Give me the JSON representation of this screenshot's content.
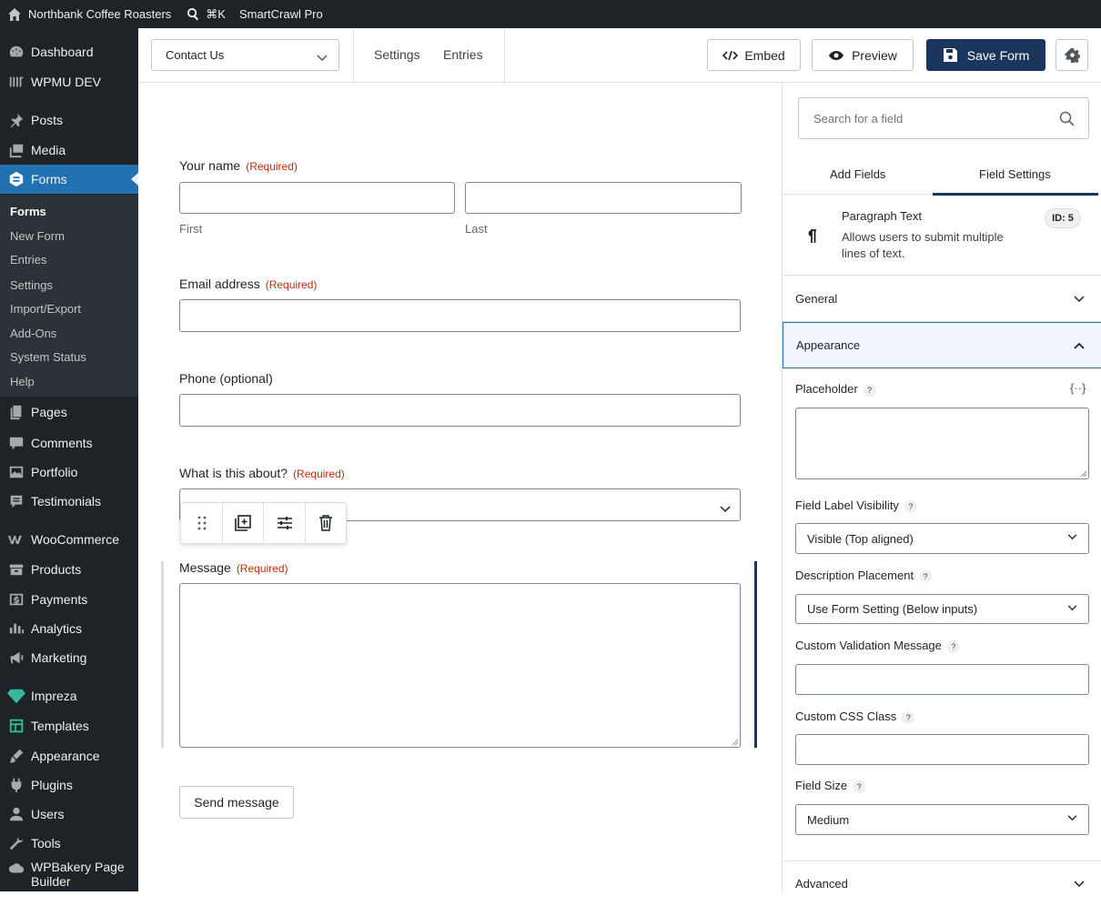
{
  "adminbar": {
    "site_name": "Northbank Coffee Roasters",
    "shortcut": "⌘K",
    "plugin": "SmartCrawl Pro"
  },
  "sidebar": {
    "items": [
      {
        "label": "Dashboard",
        "icon": "dashboard-icon"
      },
      {
        "label": "WPMU DEV",
        "icon": "wpmudev-icon"
      },
      {
        "label": "Posts",
        "icon": "pin-icon"
      },
      {
        "label": "Media",
        "icon": "media-icon"
      },
      {
        "label": "Forms",
        "icon": "forms-icon"
      },
      {
        "label": "Pages",
        "icon": "pages-icon"
      },
      {
        "label": "Comments",
        "icon": "comments-icon"
      },
      {
        "label": "Portfolio",
        "icon": "portfolio-icon"
      },
      {
        "label": "Testimonials",
        "icon": "testimonials-icon"
      },
      {
        "label": "WooCommerce",
        "icon": "woocommerce-icon"
      },
      {
        "label": "Products",
        "icon": "products-icon"
      },
      {
        "label": "Payments",
        "icon": "payments-icon"
      },
      {
        "label": "Analytics",
        "icon": "analytics-icon"
      },
      {
        "label": "Marketing",
        "icon": "marketing-icon"
      },
      {
        "label": "Impreza",
        "icon": "impreza-icon"
      },
      {
        "label": "Templates",
        "icon": "templates-icon"
      },
      {
        "label": "Appearance",
        "icon": "appearance-icon"
      },
      {
        "label": "Plugins",
        "icon": "plugins-icon"
      },
      {
        "label": "Users",
        "icon": "users-icon"
      },
      {
        "label": "Tools",
        "icon": "tools-icon"
      },
      {
        "label": "WPBakery Page Builder",
        "icon": "wpbakery-icon"
      }
    ],
    "submenu": [
      "Forms",
      "New Form",
      "Entries",
      "Settings",
      "Import/Export",
      "Add-Ons",
      "System Status",
      "Help"
    ]
  },
  "toolbar": {
    "form_select": "Contact Us",
    "tab_settings": "Settings",
    "tab_entries": "Entries",
    "embed": "Embed",
    "preview": "Preview",
    "save": "Save Form"
  },
  "form": {
    "name_label": "Your name",
    "required": "(Required)",
    "first": "First",
    "last": "Last",
    "email_label": "Email address",
    "phone_label": "Phone (optional)",
    "about_label": "What is this about?",
    "message_label": "Message",
    "submit": "Send message"
  },
  "panel": {
    "search_placeholder": "Search for a field",
    "tab_add": "Add Fields",
    "tab_settings": "Field Settings",
    "field_title": "Paragraph Text",
    "field_desc_1": "Allows users to submit multiple",
    "field_desc_2": "lines of text.",
    "field_id": "ID: 5",
    "general": "General",
    "appearance": "Appearance",
    "placeholder_label": "Placeholder",
    "merge_tag": "{··}",
    "visibility_label": "Field Label Visibility",
    "visibility_value": "Visible (Top aligned)",
    "desc_label": "Description Placement",
    "desc_value": "Use Form Setting (Below inputs)",
    "validation_label": "Custom Validation Message",
    "css_label": "Custom CSS Class",
    "size_label": "Field Size",
    "size_value": "Medium",
    "advanced": "Advanced",
    "help": "?"
  },
  "colors": {
    "accent": "#2271b1",
    "save_bg": "#1b365d",
    "admin_dark": "#1d2327",
    "required": "#c02b0a"
  }
}
